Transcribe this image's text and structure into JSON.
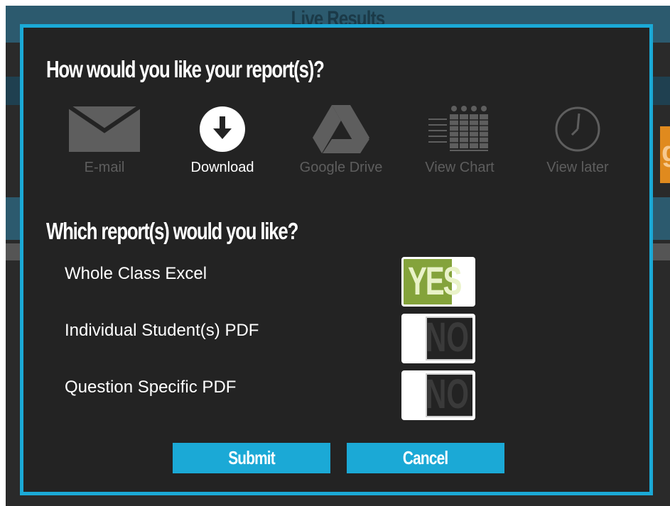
{
  "background": {
    "title": "Live Results",
    "edge_glyph": "g"
  },
  "dialog": {
    "delivery_heading": "How would you like your report(s)?",
    "report_heading": "Which report(s) would you like?",
    "delivery_options": [
      {
        "label": "E-mail",
        "icon": "envelope-icon",
        "active": false
      },
      {
        "label": "Download",
        "icon": "download-icon",
        "active": true
      },
      {
        "label": "Google Drive",
        "icon": "google-drive-icon",
        "active": false
      },
      {
        "label": "View Chart",
        "icon": "chart-icon",
        "active": false
      },
      {
        "label": "View later",
        "icon": "clock-icon",
        "active": false
      }
    ],
    "reports": [
      {
        "label": "Whole Class Excel",
        "toggle_text": "YES",
        "enabled": true
      },
      {
        "label": "Individual Student(s) PDF",
        "toggle_text": "NO",
        "enabled": false
      },
      {
        "label": "Question Specific PDF",
        "toggle_text": "NO",
        "enabled": false
      }
    ],
    "submit_label": "Submit",
    "cancel_label": "Cancel"
  },
  "colors": {
    "accent": "#1ba9d6",
    "toggle_on": "#84a33b",
    "modal_bg": "#232323",
    "inactive_text": "#5e5e5e"
  }
}
